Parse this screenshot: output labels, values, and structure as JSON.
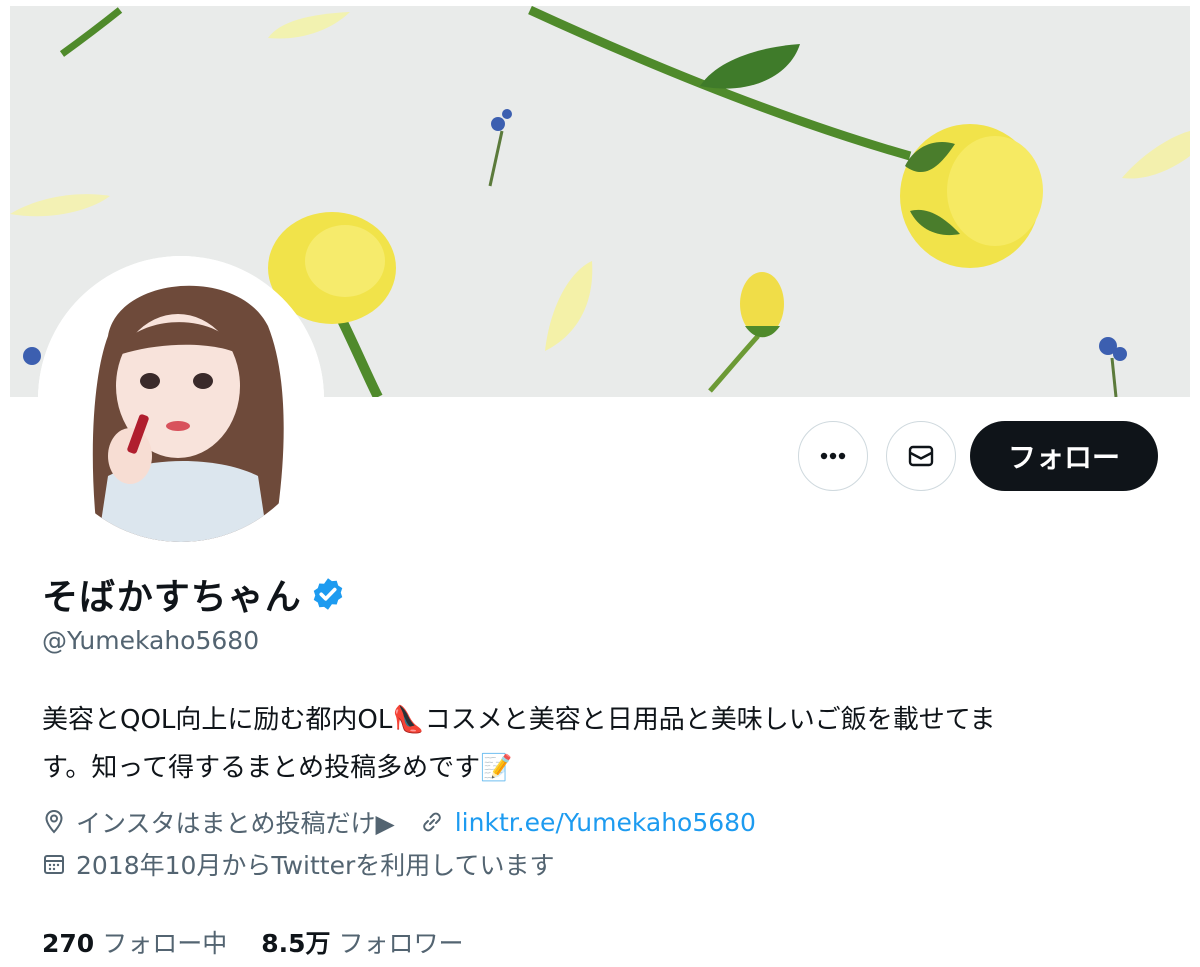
{
  "profile": {
    "display_name": "そばかすちゃん",
    "handle": "@Yumekaho5680",
    "bio_line1": "美容とQOL向上に励む都内OL👠コスメと美容と日用品と美味しいご飯を載せてま",
    "bio_line2": "す。知って得するまとめ投稿多めです📝",
    "location": "インスタはまとめ投稿だけ▶",
    "website": "linktr.ee/Yumekaho5680",
    "joined": "2018年10月からTwitterを利用しています",
    "verified": true
  },
  "actions": {
    "more_icon": "more-horizontal-icon",
    "message_icon": "envelope-icon",
    "follow_label": "フォロー"
  },
  "stats": {
    "following_count": "270",
    "following_label": "フォロー中",
    "followers_count": "8.5万",
    "followers_label": "フォロワー"
  },
  "colors": {
    "accent": "#1d9bf0",
    "text_primary": "#0f1419",
    "text_secondary": "#536471",
    "follow_button": "#0f1419",
    "border": "#cfd9de"
  }
}
